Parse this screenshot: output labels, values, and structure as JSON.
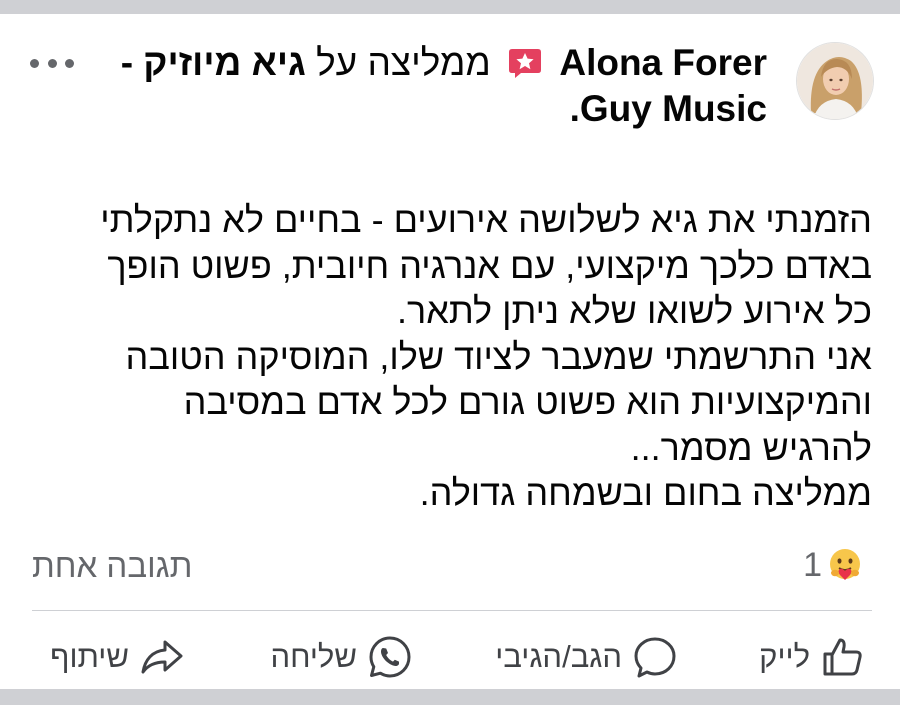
{
  "post": {
    "author": "Alona Forer",
    "recommends_prefix": "ממליצה על",
    "page_name": "גיא מיוזיק -",
    "page_name_en": "Guy Music",
    "page_name_end": ".",
    "body_lines": [
      "הזמנתי את גיא לשלושה אירועים - בחיים לא נתקלתי",
      "באדם כלכך מיקצועי, עם אנרגיה חיובית, פשוט הופך",
      "כל אירוע לשואו שלא ניתן לתאר.",
      "אני התרשמתי שמעבר לציוד שלו, המוסיקה הטובה",
      "והמיקצועיות הוא פשוט גורם לכל אדם במסיבה",
      "להרגיש מסמר...",
      "ממליצה בחום ובשמחה גדולה."
    ],
    "reaction_count": "1",
    "comments_label": "תגובה אחת"
  },
  "actions": {
    "like": "לייק",
    "comment": "הגב/הגיבי",
    "send": "שליחה",
    "share": "שיתוף"
  },
  "icons": {
    "recommend": "recommend-star-icon",
    "reaction": "care-emoji-icon",
    "like": "thumbs-up-icon",
    "comment": "comment-bubble-icon",
    "send": "whatsapp-icon",
    "share": "share-arrow-icon",
    "more": "more-dots-icon"
  },
  "colors": {
    "recommend_badge": "#e4405f",
    "secondary_text": "#65676b",
    "action_text": "#404246"
  }
}
